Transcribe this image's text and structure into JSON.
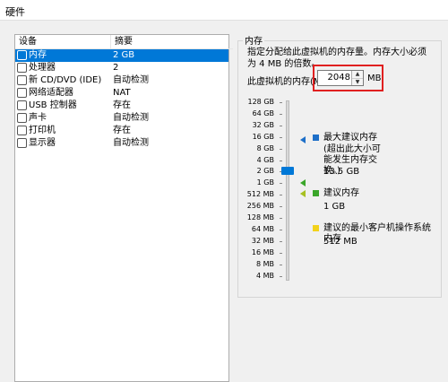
{
  "window": {
    "title": "硬件"
  },
  "devices": {
    "header_device": "设备",
    "header_summary": "摘要",
    "rows": [
      {
        "name": "内存",
        "summary": "2 GB",
        "icon": "memory-icon"
      },
      {
        "name": "处理器",
        "summary": "2",
        "icon": "cpu-icon"
      },
      {
        "name": "新 CD/DVD (IDE)",
        "summary": "自动检测",
        "icon": "cd-icon"
      },
      {
        "name": "网络适配器",
        "summary": "NAT",
        "icon": "network-icon"
      },
      {
        "name": "USB 控制器",
        "summary": "存在",
        "icon": "usb-icon"
      },
      {
        "name": "声卡",
        "summary": "自动检测",
        "icon": "sound-icon"
      },
      {
        "name": "打印机",
        "summary": "存在",
        "icon": "printer-icon"
      },
      {
        "name": "显示器",
        "summary": "自动检测",
        "icon": "display-icon"
      }
    ],
    "selected_index": 0
  },
  "memory": {
    "group_label": "内存",
    "description": "指定分配给此虚拟机的内存量。内存大小必须为 4 MB 的倍数。",
    "field_label": "此虚拟机的内存(M):",
    "value": "2048",
    "unit": "MB",
    "scale": [
      "64 GB",
      "32 GB",
      "16 GB",
      "8 GB",
      "4 GB",
      "2 GB",
      "1 GB",
      "512 MB",
      "256 MB",
      "128 MB",
      "64 MB",
      "32 MB",
      "16 MB",
      "8 MB",
      "4 MB"
    ],
    "scale_top": "128 GB",
    "max_label": "最大建议内存",
    "max_note": "(超出此大小可能发生内存交换。)",
    "max_value": "13.5 GB",
    "rec_label": "建议内存",
    "rec_value": "1 GB",
    "min_label": "建议的最小客户机操作系统内存",
    "min_value": "512 MB",
    "colors": {
      "max": "#1e6fc8",
      "rec": "#3aa62a",
      "min": "#f2d21b",
      "accent": "#0078d7",
      "highlight": "#e02020"
    }
  }
}
